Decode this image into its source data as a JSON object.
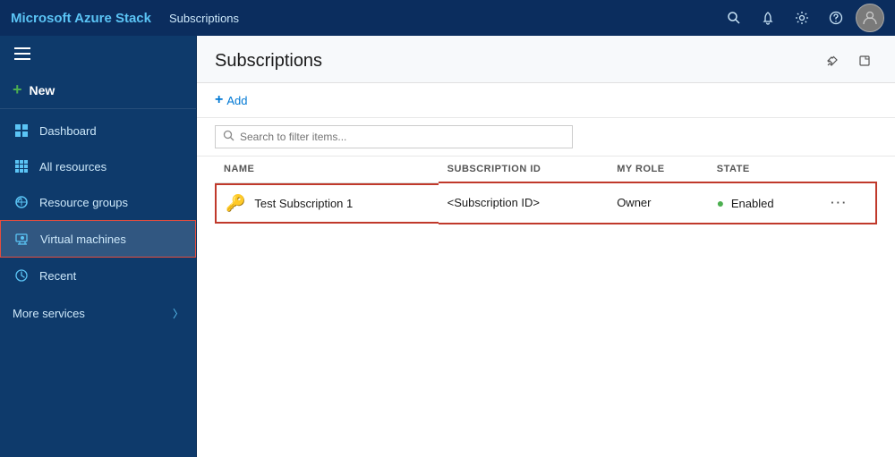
{
  "app": {
    "title": "Microsoft Azure Stack",
    "header_subtitle": "Subscriptions",
    "page_title": "Subscriptions"
  },
  "topbar": {
    "icons": [
      "search",
      "bell",
      "settings",
      "help"
    ],
    "search_title": "Search",
    "bell_title": "Notifications",
    "settings_title": "Settings",
    "help_title": "Help"
  },
  "sidebar": {
    "new_label": "New",
    "items": [
      {
        "id": "dashboard",
        "label": "Dashboard",
        "icon": "dashboard-icon"
      },
      {
        "id": "all-resources",
        "label": "All resources",
        "icon": "all-resources-icon"
      },
      {
        "id": "resource-groups",
        "label": "Resource groups",
        "icon": "resource-groups-icon"
      },
      {
        "id": "virtual-machines",
        "label": "Virtual machines",
        "icon": "virtual-machines-icon",
        "active": true
      },
      {
        "id": "recent",
        "label": "Recent",
        "icon": "recent-icon"
      }
    ],
    "more_services_label": "More services"
  },
  "content": {
    "add_label": "Add",
    "search_placeholder": "Search to filter items...",
    "columns": [
      "NAME",
      "SUBSCRIPTION ID",
      "MY ROLE",
      "STATE"
    ],
    "rows": [
      {
        "name": "Test Subscription 1",
        "subscription_id": "<Subscription ID>",
        "role": "Owner",
        "state": "Enabled",
        "highlighted": true
      }
    ]
  }
}
